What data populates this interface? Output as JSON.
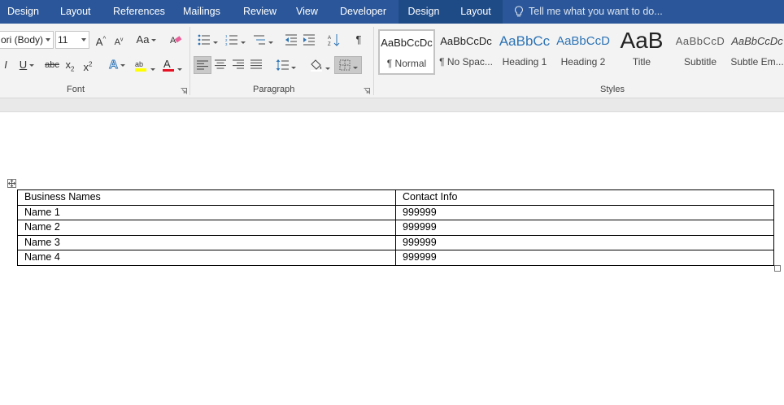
{
  "tabs": [
    {
      "label": "Design",
      "contextual": false
    },
    {
      "label": "Layout",
      "contextual": false
    },
    {
      "label": "References",
      "contextual": false
    },
    {
      "label": "Mailings",
      "contextual": false
    },
    {
      "label": "Review",
      "contextual": false
    },
    {
      "label": "View",
      "contextual": false
    },
    {
      "label": "Developer",
      "contextual": false
    },
    {
      "label": "Design",
      "contextual": true
    },
    {
      "label": "Layout",
      "contextual": true
    }
  ],
  "tell_me": "Tell me what you want to do...",
  "font": {
    "name": "ori (Body)",
    "size": "11",
    "group_label": "Font"
  },
  "paragraph": {
    "group_label": "Paragraph"
  },
  "styles": {
    "group_label": "Styles",
    "items": [
      {
        "sample": "AaBbCcDc",
        "name": "¶ Normal"
      },
      {
        "sample": "AaBbCcDc",
        "name": "¶ No Spac..."
      },
      {
        "sample": "AaBbCc",
        "name": "Heading 1"
      },
      {
        "sample": "AaBbCcD",
        "name": "Heading 2"
      },
      {
        "sample": "AaB",
        "name": "Title"
      },
      {
        "sample": "AaBbCcD",
        "name": "Subtitle"
      },
      {
        "sample": "AaBbCcDc",
        "name": "Subtle Em..."
      }
    ]
  },
  "table": {
    "headers": [
      "Business Names",
      "Contact Info"
    ],
    "rows": [
      [
        "Name 1",
        "999999"
      ],
      [
        "Name 2",
        "999999"
      ],
      [
        "Name 3",
        "999999"
      ],
      [
        "Name 4",
        "999999"
      ]
    ]
  },
  "colors": {
    "tab_bar": "#2b579a",
    "contextual_tab": "#1e4a86",
    "highlight": "#ffff00",
    "font_color": "#e81123",
    "heading_blue": "#2e74b5"
  }
}
